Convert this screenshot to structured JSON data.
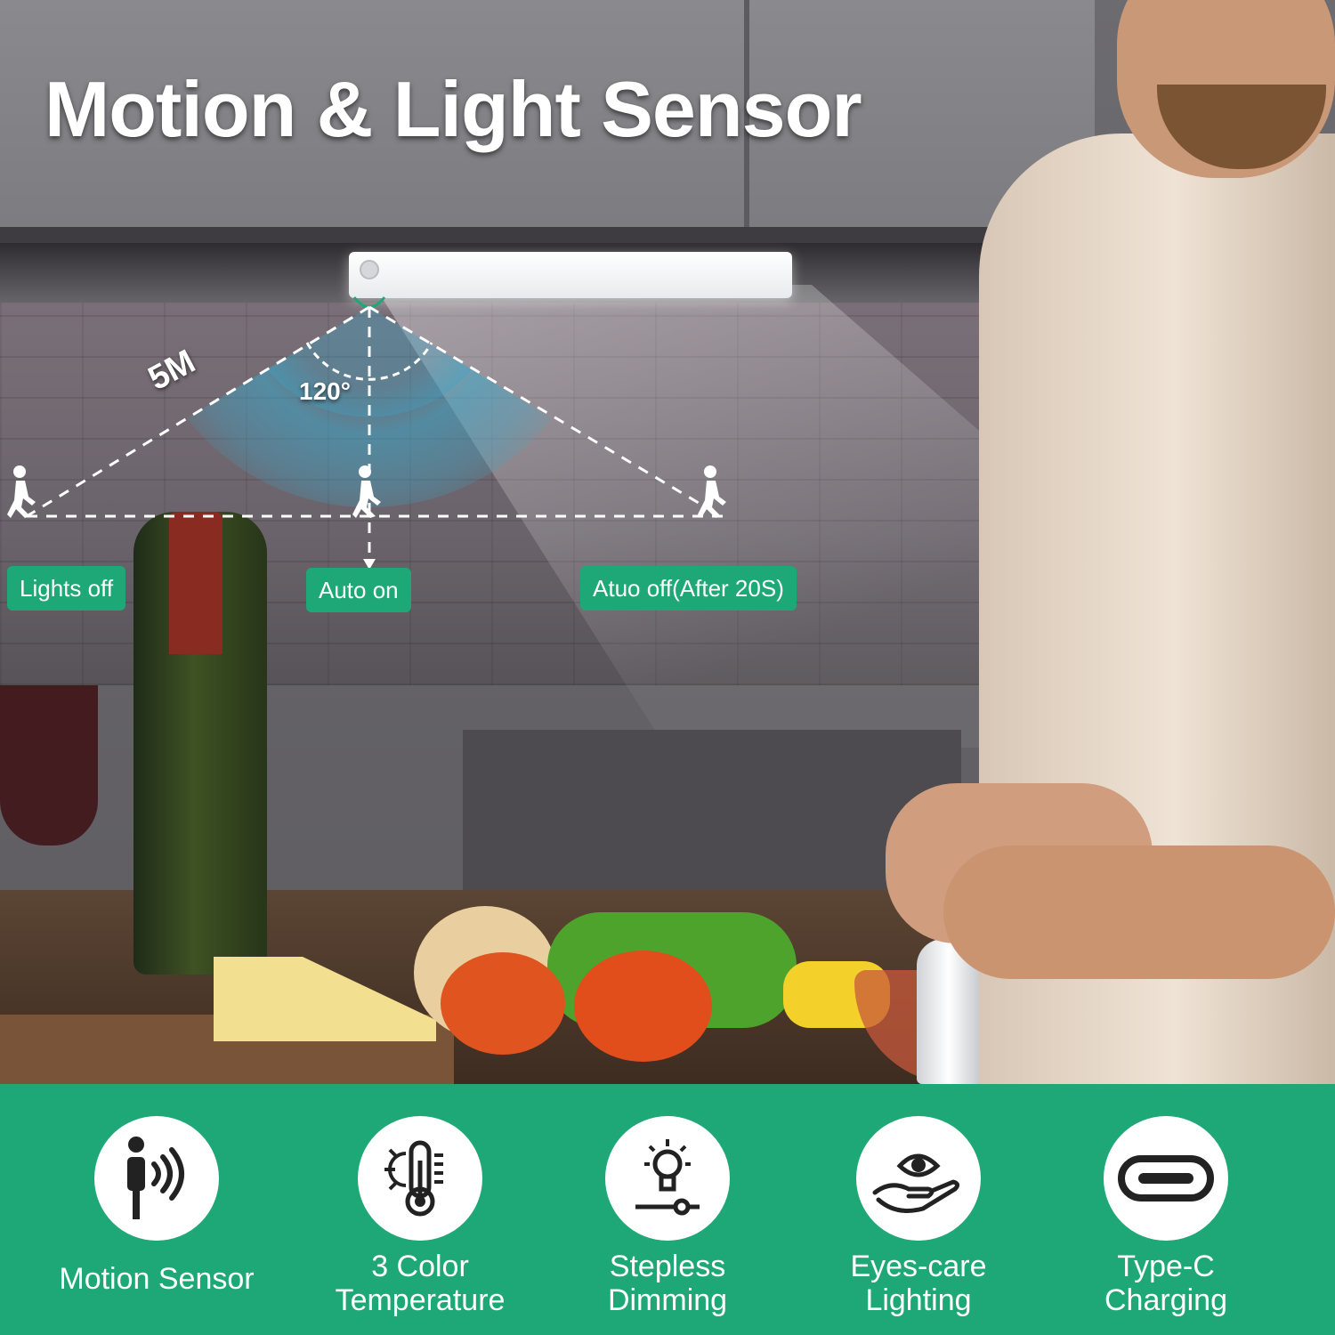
{
  "headline": "Motion & Light Sensor",
  "diagram": {
    "angle": "120°",
    "distance": "5M",
    "states": {
      "lights_off": "Lights off",
      "auto_on": "Auto on",
      "auto_off": "Atuo off(After 20S)"
    }
  },
  "features": [
    {
      "icon": "motion-sensor-icon",
      "label_line1": "Motion Sensor",
      "label_line2": ""
    },
    {
      "icon": "thermometer-icon",
      "label_line1": "3 Color",
      "label_line2": "Temperature"
    },
    {
      "icon": "dimming-bulb-icon",
      "label_line1": "Stepless",
      "label_line2": "Dimming"
    },
    {
      "icon": "eye-hand-icon",
      "label_line1": "Eyes-care",
      "label_line2": "Lighting"
    },
    {
      "icon": "type-c-port-icon",
      "label_line1": "Type-C",
      "label_line2": "Charging"
    }
  ],
  "colors": {
    "brand_green": "#1ea878",
    "text": "#ffffff",
    "sensor_wave": "#3aa7c9",
    "icon": "#222222"
  }
}
